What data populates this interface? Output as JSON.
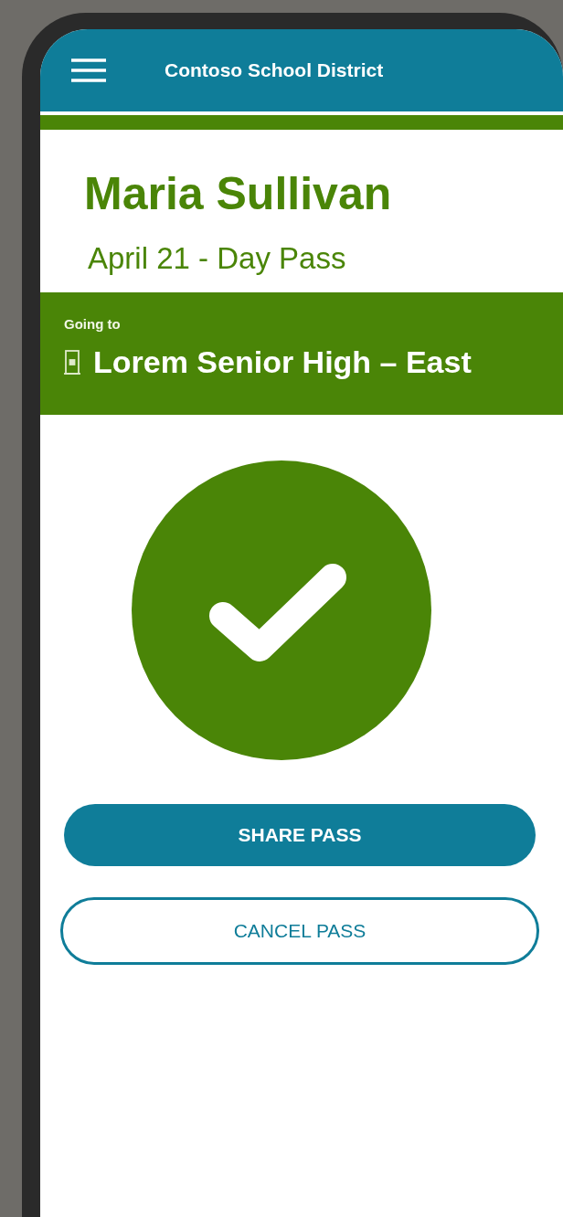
{
  "header": {
    "title": "Contoso School District"
  },
  "pass": {
    "name": "Maria Sullivan",
    "date": "April 21 - Day Pass"
  },
  "destination": {
    "label": "Going to",
    "name": "Lorem Senior High – East"
  },
  "status": {
    "kind": "approved"
  },
  "buttons": [
    {
      "label": "SHARE PASS",
      "kind": "primary"
    },
    {
      "label": "CANCEL PASS",
      "kind": "secondary"
    }
  ]
}
